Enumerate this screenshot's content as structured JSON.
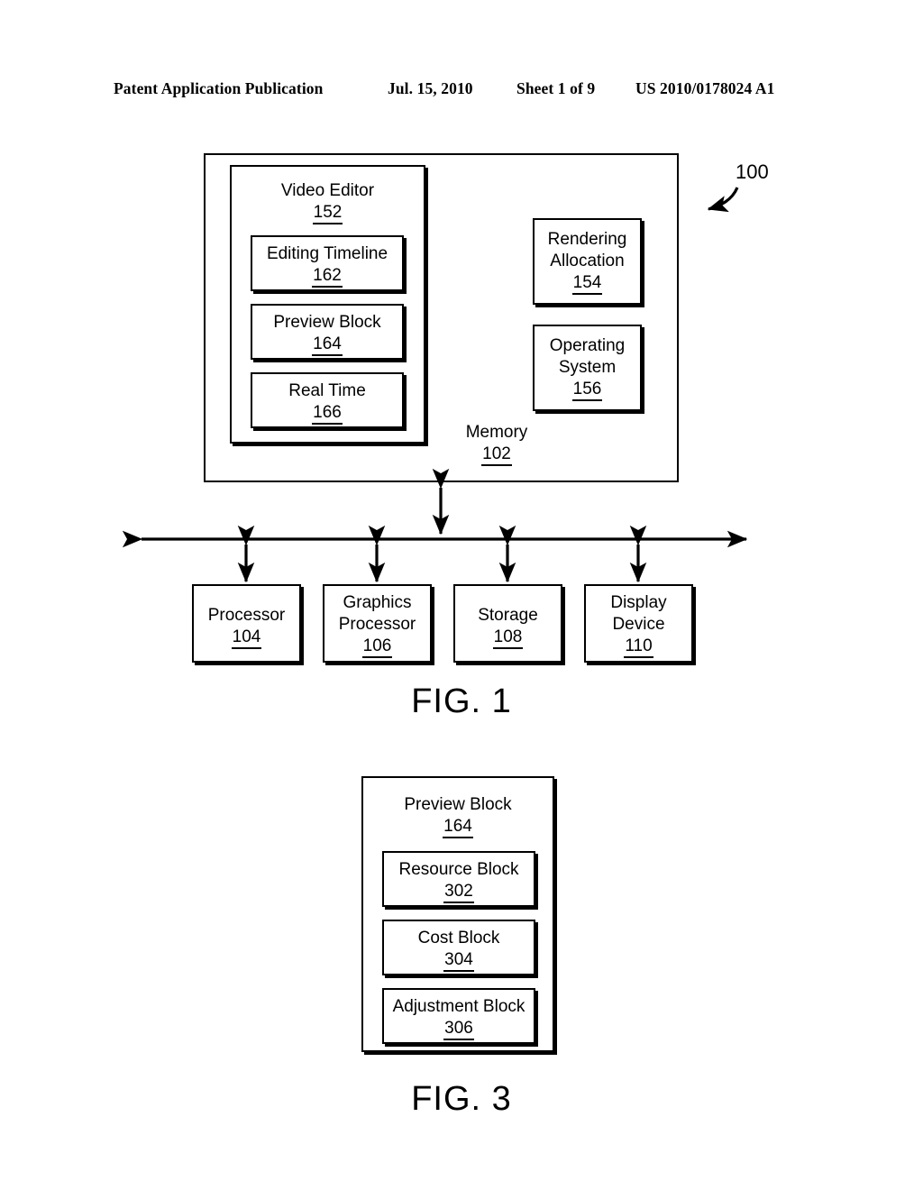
{
  "header": {
    "publication": "Patent Application Publication",
    "date": "Jul. 15, 2010",
    "sheet": "Sheet 1 of 9",
    "patent_number": "US 2010/0178024 A1"
  },
  "figure1": {
    "caption": "FIG. 1",
    "system_ref": "100",
    "memory": {
      "label": "Memory",
      "ref": "102"
    },
    "video_editor": {
      "label": "Video Editor",
      "ref": "152",
      "children": [
        {
          "label": "Editing Timeline",
          "ref": "162"
        },
        {
          "label": "Preview Block",
          "ref": "164"
        },
        {
          "label": "Real Time",
          "ref": "166"
        }
      ]
    },
    "memory_modules": [
      {
        "label": "Rendering\nAllocation",
        "ref": "154"
      },
      {
        "label": "Operating\nSystem",
        "ref": "156"
      }
    ],
    "devices": [
      {
        "label": "Processor",
        "ref": "104"
      },
      {
        "label": "Graphics\nProcessor",
        "ref": "106"
      },
      {
        "label": "Storage",
        "ref": "108"
      },
      {
        "label": "Display\nDevice",
        "ref": "110"
      }
    ]
  },
  "figure3": {
    "caption": "FIG. 3",
    "preview_block": {
      "label": "Preview Block",
      "ref": "164",
      "children": [
        {
          "label": "Resource Block",
          "ref": "302"
        },
        {
          "label": "Cost Block",
          "ref": "304"
        },
        {
          "label": "Adjustment Block",
          "ref": "306"
        }
      ]
    }
  },
  "colors": {
    "ink": "#000000",
    "paper": "#ffffff"
  }
}
